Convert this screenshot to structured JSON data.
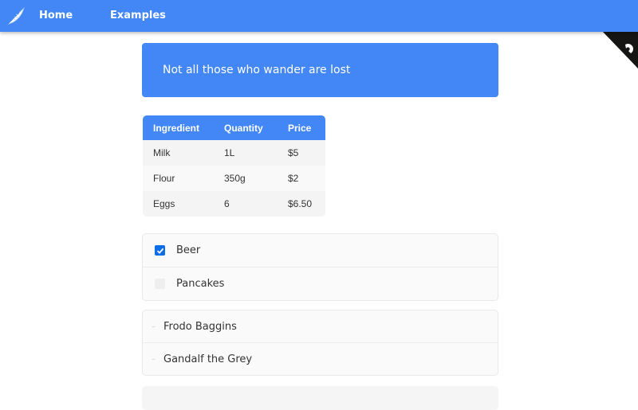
{
  "nav": {
    "logo_icon": "feather-icon",
    "links": [
      "Home",
      "Examples"
    ],
    "color": "#4287f5"
  },
  "banner": {
    "text": "Not all those who wander are lost"
  },
  "ingredients_table": {
    "headers": [
      "Ingredient",
      "Quantity",
      "Price"
    ],
    "rows": [
      [
        "Milk",
        "1L",
        "$5"
      ],
      [
        "Flour",
        "350g",
        "$2"
      ],
      [
        "Eggs",
        "6",
        "$6.50"
      ]
    ]
  },
  "checklist": {
    "items": [
      {
        "label": "Beer",
        "checked": true
      },
      {
        "label": "Pancakes",
        "checked": false
      }
    ]
  },
  "list": {
    "items": [
      "Frodo Baggins",
      "Gandalf the Grey"
    ]
  }
}
